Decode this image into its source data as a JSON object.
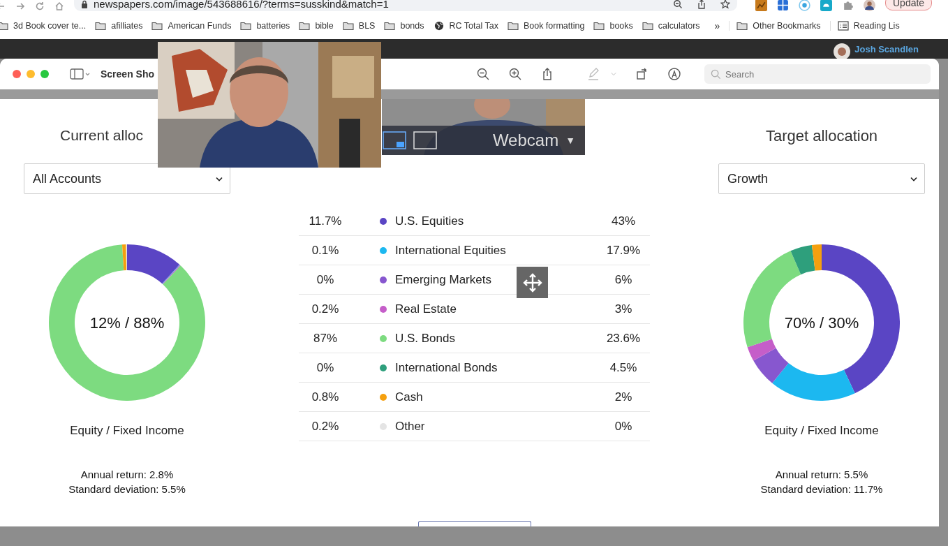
{
  "browser": {
    "url": "newspapers.com/image/543688616/?terms=susskind&match=1",
    "update_button": "Update",
    "bookmarks": [
      {
        "label": "3d Book cover te...",
        "kind": "folder"
      },
      {
        "label": "afilliates",
        "kind": "folder"
      },
      {
        "label": "American Funds",
        "kind": "folder"
      },
      {
        "label": "batteries",
        "kind": "folder"
      },
      {
        "label": "bible",
        "kind": "folder"
      },
      {
        "label": "BLS",
        "kind": "folder"
      },
      {
        "label": "bonds",
        "kind": "folder"
      },
      {
        "label": "RC Total Tax",
        "kind": "globe"
      },
      {
        "label": "Book formatting",
        "kind": "folder"
      },
      {
        "label": "books",
        "kind": "folder"
      },
      {
        "label": "calculators",
        "kind": "folder"
      }
    ],
    "overflow": "»",
    "other_bookmarks": "Other Bookmarks",
    "reading_list": "Reading Lis"
  },
  "site": {
    "user": "Josh Scandlen"
  },
  "viewer": {
    "title": "Screen Sho",
    "search_placeholder": "Search"
  },
  "webcam": {
    "label": "Webcam",
    "caret": "▼"
  },
  "current": {
    "title": "Current alloc",
    "account": "All Accounts",
    "center": "12% / 88%",
    "caption": "Equity / Fixed Income",
    "annual_return": "Annual return: 2.8%",
    "std_dev": "Standard deviation: 5.5%",
    "chart_data": {
      "type": "donut",
      "values": [
        11.7,
        0.1,
        0,
        0.2,
        87,
        0,
        0.8,
        0.2
      ]
    }
  },
  "target": {
    "title": "Target allocation",
    "account": "Growth",
    "center": "70% / 30%",
    "caption": "Equity / Fixed Income",
    "annual_return": "Annual return: 5.5%",
    "std_dev": "Standard deviation: 11.7%",
    "chart_data": {
      "type": "donut",
      "values": [
        43,
        17.9,
        6,
        3,
        23.6,
        4.5,
        2,
        0
      ]
    }
  },
  "table": {
    "rows": [
      {
        "current": "11.7%",
        "name": "U.S. Equities",
        "target": "43%",
        "color": "#5a45c4"
      },
      {
        "current": "0.1%",
        "name": "International Equities",
        "target": "17.9%",
        "color": "#1cb8f0"
      },
      {
        "current": "0%",
        "name": "Emerging Markets",
        "target": "6%",
        "color": "#8757cf"
      },
      {
        "current": "0.2%",
        "name": "Real Estate",
        "target": "3%",
        "color": "#c55ec9"
      },
      {
        "current": "87%",
        "name": "U.S. Bonds",
        "target": "23.6%",
        "color": "#7ddb80"
      },
      {
        "current": "0%",
        "name": "International Bonds",
        "target": "4.5%",
        "color": "#2e9f7c"
      },
      {
        "current": "0.8%",
        "name": "Cash",
        "target": "2%",
        "color": "#f5a00f"
      },
      {
        "current": "0.2%",
        "name": "Other",
        "target": "0%",
        "color": "#e4e4e4"
      }
    ]
  }
}
